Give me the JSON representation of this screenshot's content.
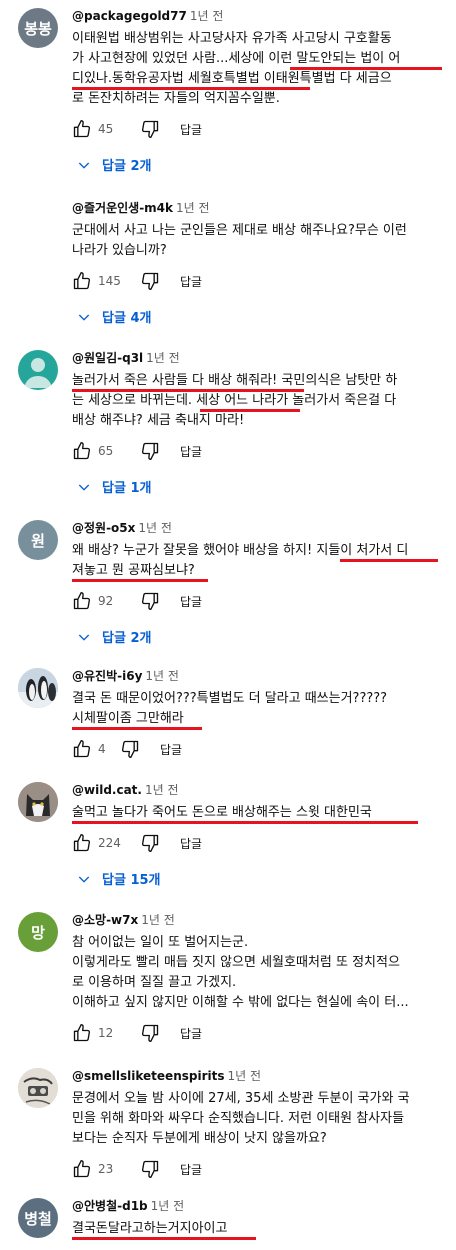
{
  "colors": {
    "accent": "#065fd4",
    "underline": "#e5141f",
    "meta": "#606060"
  },
  "comments": [
    {
      "author": "@packagegold77",
      "time": "1년 전",
      "avatar": {
        "text": "봉봉",
        "color": "#6d7a86"
      },
      "lines": [
        "이태원법 배상범위는 사고당사자 유가족 사고당시 구호활동",
        "가 사고현장에 있었던 사람...세상에 이런 말도안되는 법이 어",
        "디있나.동학유공자법 세월호특별법 이태원특별법 다 세금으",
        "로 돈잔치하려는 자들의 억지꼼수일뿐."
      ],
      "likes": "45",
      "reply_label": "답글",
      "replies": "답글 2개"
    },
    {
      "author": "@즐거운인생-m4k",
      "time": "1년 전",
      "avatar": null,
      "lines": [
        "군대에서 사고 나는 군인들은 제대로 배상 해주나요?무슨 이런",
        "나라가 있습니까?"
      ],
      "likes": "145",
      "reply_label": "답글",
      "replies": "답글 4개"
    },
    {
      "author": "@원일김-q3l",
      "time": "1년 전",
      "avatar": {
        "text": "",
        "color": "#26a69a",
        "icon": "person-icon"
      },
      "lines": [
        "놀러가서 죽은 사람들 다 배상 해줘라! 국민의식은 남탓만 하",
        "는 세상으로 바뀌는데. 세상 어느 나라가 놀러가서 죽은걸 다",
        "배상 해주냐? 세금 축내지 마라!"
      ],
      "likes": "65",
      "reply_label": "답글",
      "replies": "답글 1개"
    },
    {
      "author": "@정원-o5x",
      "time": "1년 전",
      "avatar": {
        "text": "원",
        "color": "#78909c"
      },
      "lines": [
        "왜 배상? 누군가 잘못을 했어야 배상을 하지! 지들이 처가서 디",
        "져놓고 뭔 공짜심보냐?"
      ],
      "likes": "92",
      "reply_label": "답글",
      "replies": "답글 2개"
    },
    {
      "author": "@유진박-i6y",
      "time": "1년 전",
      "avatar": {
        "text": "",
        "color": "#9fb4c8",
        "icon": "penguins-photo"
      },
      "lines": [
        "결국 돈 때문이었어???특별법도 더 달라고 때쓰는거?????",
        "시체팔이좀 그만해라"
      ],
      "likes": "4",
      "reply_label": "답글",
      "replies": ""
    },
    {
      "author": "@wild.cat.",
      "time": "1년 전",
      "avatar": {
        "text": "",
        "color": "#8c7f78",
        "icon": "cat-photo"
      },
      "lines": [
        "술먹고 놀다가 죽어도 돈으로 배상해주는 스윗 대한민국"
      ],
      "likes": "224",
      "reply_label": "답글",
      "replies": "답글 15개"
    },
    {
      "author": "@소망-w7x",
      "time": "1년 전",
      "avatar": {
        "text": "망",
        "color": "#689f38"
      },
      "lines": [
        "참 어이없는 일이 또 벌어지는군.",
        "이렇게라도 빨리 매듭 짓지 않으면 세월호때처럼 또 정치적으",
        "로 이용하며 질질 끌고 가겠지.",
        "이해하고 싶지 않지만 이해할 수 밖에 없다는 현실에 속이 터..."
      ],
      "likes": "12",
      "reply_label": "답글",
      "replies": ""
    },
    {
      "author": "@smellsliketeenspirits",
      "time": "1년 전",
      "avatar": {
        "text": "",
        "color": "#d8d4cc",
        "icon": "sketch-photo"
      },
      "lines": [
        "문경에서 오늘 밤 사이에 27세, 35세 소방관 두분이 국가와 국",
        "민을 위해 화마와 싸우다 순직했습니다. 저런 이태원 참사자들",
        "보다는 순직자 두분에게 배상이 낫지 않을까요?"
      ],
      "likes": "23",
      "reply_label": "답글",
      "replies": ""
    },
    {
      "author": "@안병철-d1b",
      "time": "1년 전",
      "avatar": {
        "text": "병철",
        "color": "#5c6f80"
      },
      "lines": [
        "결국돈달라고하는거지아이고"
      ],
      "likes": "",
      "reply_label": "",
      "replies": ""
    }
  ]
}
